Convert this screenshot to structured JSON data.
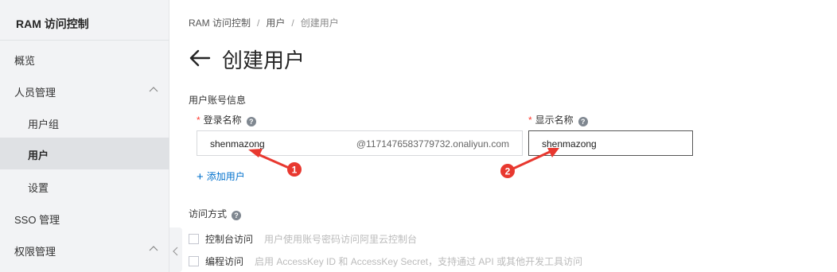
{
  "app": {
    "title": "RAM 访问控制"
  },
  "sidebar": {
    "items": [
      {
        "label": "概览"
      },
      {
        "label": "人员管理"
      },
      {
        "label": "用户组"
      },
      {
        "label": "用户"
      },
      {
        "label": "设置"
      },
      {
        "label": "SSO 管理"
      },
      {
        "label": "权限管理"
      }
    ],
    "active": "用户"
  },
  "breadcrumb": {
    "items": [
      "RAM 访问控制",
      "用户",
      "创建用户"
    ]
  },
  "page": {
    "title": "创建用户"
  },
  "form": {
    "section_title": "用户账号信息",
    "login_label": "登录名称",
    "login_value": "shenmazong",
    "login_suffix": "@1171476583779732.onaliyun.com",
    "display_label": "显示名称",
    "display_value": "shenmazong",
    "add_user": "添加用户",
    "required_mark": "*",
    "help_mark": "?"
  },
  "access": {
    "title": "访问方式",
    "options": [
      {
        "label": "控制台访问",
        "desc": "用户使用账号密码访问阿里云控制台"
      },
      {
        "label": "编程访问",
        "desc": "启用 AccessKey ID 和 AccessKey Secret，支持通过 API 或其他开发工具访问"
      }
    ]
  },
  "annotations": {
    "marker1": "1",
    "marker2": "2"
  },
  "colors": {
    "accent": "#ff6a00",
    "link": "#0070cc",
    "annotation": "#e8382f"
  }
}
